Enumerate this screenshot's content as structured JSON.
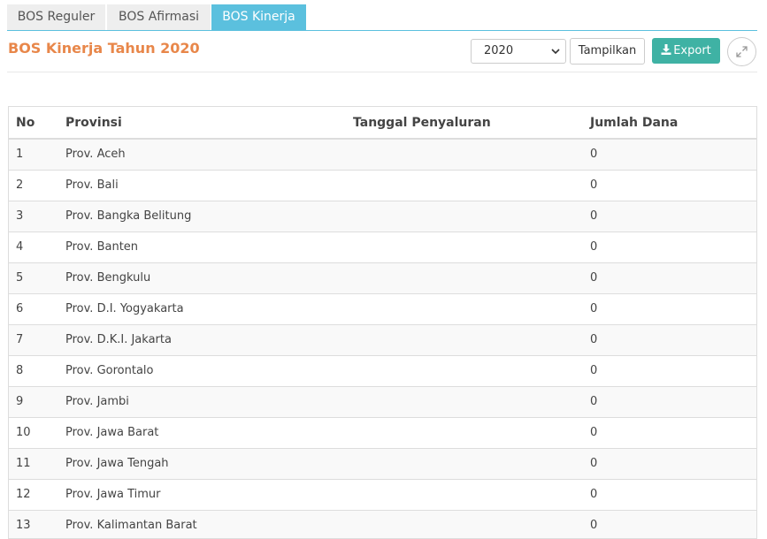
{
  "tabs": [
    {
      "label": "BOS Reguler",
      "active": false
    },
    {
      "label": "BOS Afirmasi",
      "active": false
    },
    {
      "label": "BOS Kinerja",
      "active": true
    }
  ],
  "title": "BOS Kinerja Tahun 2020",
  "toolbar": {
    "year_select_value": "2020",
    "show_label": "Tampilkan",
    "export_label": "Export",
    "export_icon": "download-icon",
    "expand_icon": "expand-icon"
  },
  "colors": {
    "tab_active": "#5bc0de",
    "title": "#e8874a",
    "export_button": "#3fb2a4"
  },
  "table": {
    "columns": [
      "No",
      "Provinsi",
      "Tanggal Penyaluran",
      "Jumlah Dana"
    ],
    "rows": [
      {
        "no": "1",
        "provinsi": "Prov. Aceh",
        "tanggal": "",
        "dana": "0"
      },
      {
        "no": "2",
        "provinsi": "Prov. Bali",
        "tanggal": "",
        "dana": "0"
      },
      {
        "no": "3",
        "provinsi": "Prov. Bangka Belitung",
        "tanggal": "",
        "dana": "0"
      },
      {
        "no": "4",
        "provinsi": "Prov. Banten",
        "tanggal": "",
        "dana": "0"
      },
      {
        "no": "5",
        "provinsi": "Prov. Bengkulu",
        "tanggal": "",
        "dana": "0"
      },
      {
        "no": "6",
        "provinsi": "Prov. D.I. Yogyakarta",
        "tanggal": "",
        "dana": "0"
      },
      {
        "no": "7",
        "provinsi": "Prov. D.K.I. Jakarta",
        "tanggal": "",
        "dana": "0"
      },
      {
        "no": "8",
        "provinsi": "Prov. Gorontalo",
        "tanggal": "",
        "dana": "0"
      },
      {
        "no": "9",
        "provinsi": "Prov. Jambi",
        "tanggal": "",
        "dana": "0"
      },
      {
        "no": "10",
        "provinsi": "Prov. Jawa Barat",
        "tanggal": "",
        "dana": "0"
      },
      {
        "no": "11",
        "provinsi": "Prov. Jawa Tengah",
        "tanggal": "",
        "dana": "0"
      },
      {
        "no": "12",
        "provinsi": "Prov. Jawa Timur",
        "tanggal": "",
        "dana": "0"
      },
      {
        "no": "13",
        "provinsi": "Prov. Kalimantan Barat",
        "tanggal": "",
        "dana": "0"
      }
    ]
  }
}
